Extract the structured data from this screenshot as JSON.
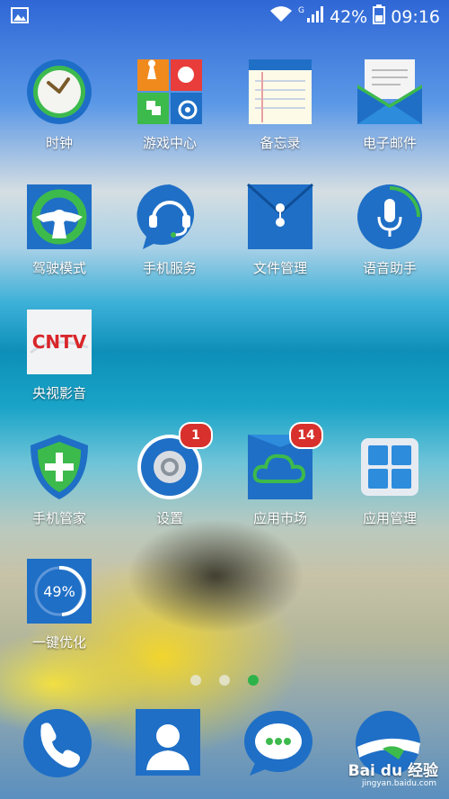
{
  "status_bar": {
    "network_type": "G",
    "battery": "42%",
    "time": "09:16",
    "icons": [
      "picture-icon",
      "wifi-icon",
      "signal-icon",
      "battery-icon"
    ]
  },
  "apps": [
    {
      "label": "时钟",
      "icon": "clock-icon"
    },
    {
      "label": "游戏中心",
      "icon": "game-center-icon"
    },
    {
      "label": "备忘录",
      "icon": "memo-icon"
    },
    {
      "label": "电子邮件",
      "icon": "email-icon"
    },
    {
      "label": "驾驶模式",
      "icon": "steering-wheel-icon"
    },
    {
      "label": "手机服务",
      "icon": "headset-icon"
    },
    {
      "label": "文件管理",
      "icon": "file-folder-icon"
    },
    {
      "label": "语音助手",
      "icon": "microphone-icon"
    },
    {
      "label": "央视影音",
      "icon": "cntv-icon",
      "logo_text": "CNTV"
    },
    {
      "label": "手机管家",
      "icon": "shield-icon"
    },
    {
      "label": "设置",
      "icon": "gear-icon",
      "badge": "1"
    },
    {
      "label": "应用市场",
      "icon": "cloud-store-icon",
      "badge": "14"
    },
    {
      "label": "应用管理",
      "icon": "grid-icon"
    },
    {
      "label": "一键优化",
      "icon": "optimize-icon",
      "percent": "49%"
    }
  ],
  "page_indicator": {
    "count": 3,
    "active": 3
  },
  "dock": [
    {
      "name": "phone",
      "icon": "phone-icon"
    },
    {
      "name": "contacts",
      "icon": "contacts-icon"
    },
    {
      "name": "messages",
      "icon": "messages-icon"
    },
    {
      "name": "browser",
      "icon": "browser-icon"
    }
  ],
  "watermark": {
    "text": "Bai du 经验",
    "sub": "jingyan.baidu.com"
  },
  "colors": {
    "accent_green": "#2db34a",
    "badge_red": "#d8302c",
    "icon_blue": "#1760b8"
  }
}
